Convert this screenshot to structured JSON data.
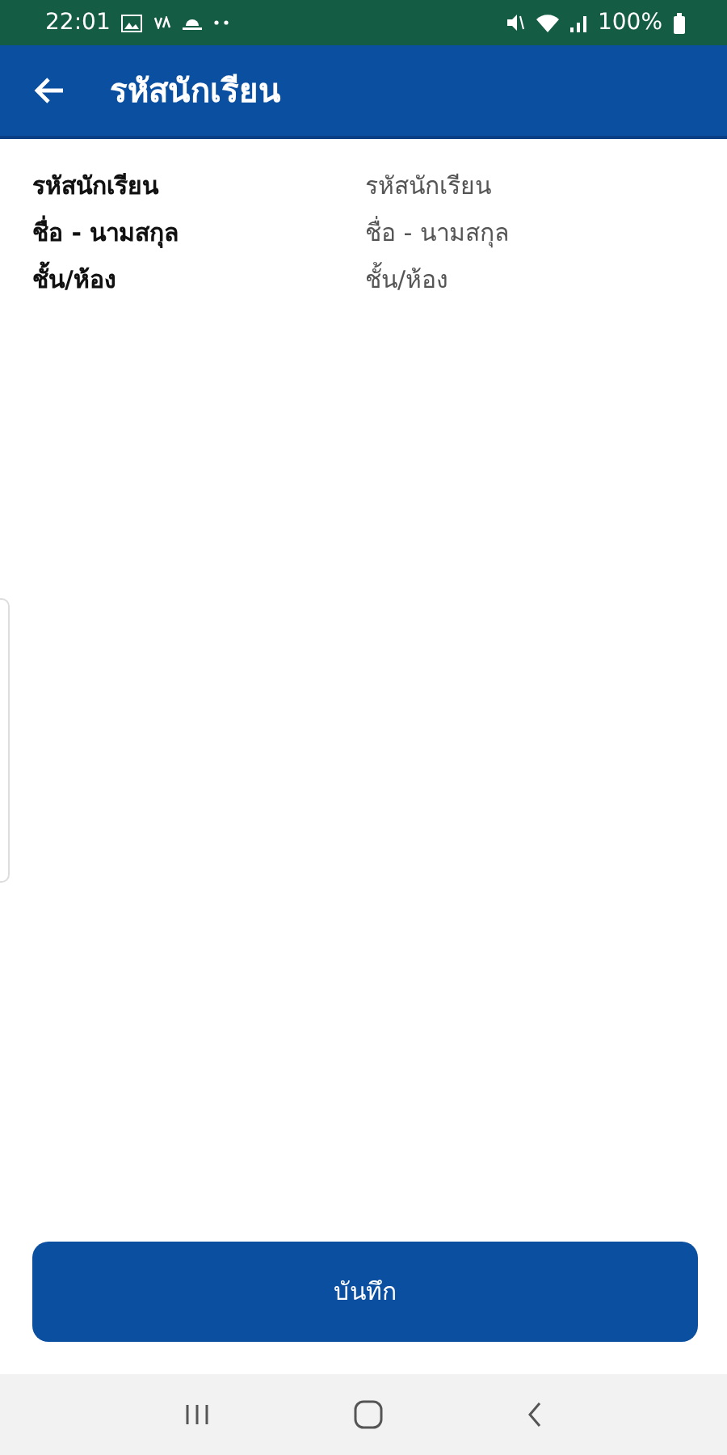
{
  "status_bar": {
    "time": "22:01",
    "battery": "100%"
  },
  "app_bar": {
    "title": "รหัสนักเรียน"
  },
  "fields": [
    {
      "label": "รหัสนักเรียน",
      "value": "รหัสนักเรียน"
    },
    {
      "label": "ชื่อ - นามสกุล",
      "value": "ชื่อ - นามสกุล"
    },
    {
      "label": "ชั้น/ห้อง",
      "value": "ชั้น/ห้อง"
    }
  ],
  "save_button": {
    "label": "บันทึก"
  }
}
